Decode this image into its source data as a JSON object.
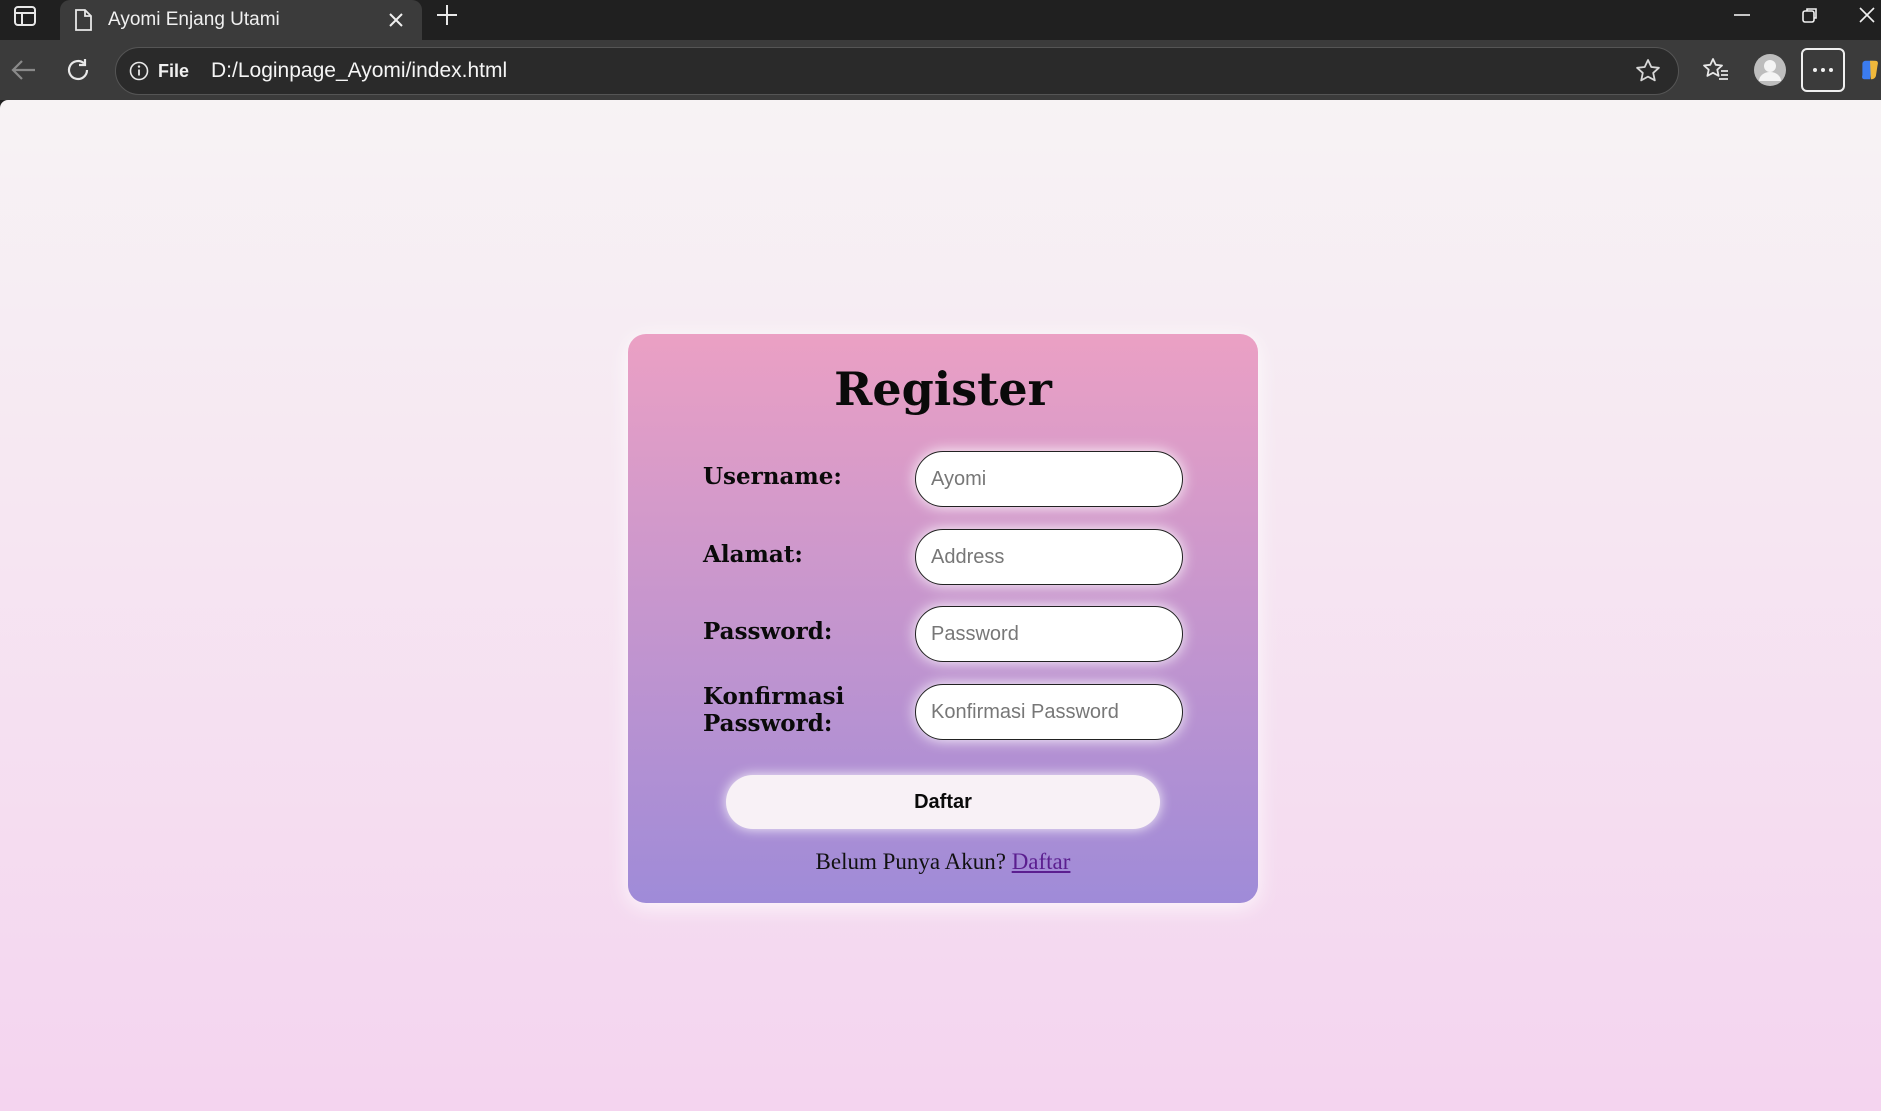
{
  "browser": {
    "tab": {
      "title": "Ayomi Enjang Utami"
    },
    "address": {
      "scheme": "File",
      "url": "D:/Loginpage_Ayomi/index.html"
    }
  },
  "form": {
    "title": "Register",
    "fields": [
      {
        "label": "Username:",
        "placeholder": "Ayomi"
      },
      {
        "label": "Alamat:",
        "placeholder": "Address"
      },
      {
        "label": "Password:",
        "placeholder": "Password"
      },
      {
        "label_line1": "Konfirmasi",
        "label_line2": "Password:",
        "placeholder": "Konfirmasi Password"
      }
    ],
    "submit_label": "Daftar",
    "footer_text": "Belum Punya Akun?",
    "footer_link": "Daftar"
  },
  "colors": {
    "page_gradient_top": "#f7f3f4",
    "page_gradient_bottom": "#f4d4ef",
    "card_gradient_top": "#eba0c4",
    "card_gradient_bottom": "#9f8bd8",
    "link": "#5b1e8f"
  }
}
